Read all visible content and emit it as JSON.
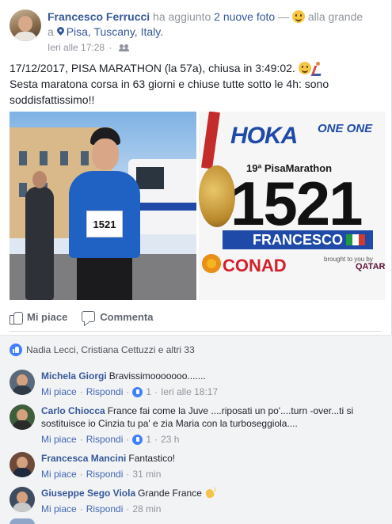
{
  "post": {
    "author": "Francesco Ferrucci",
    "action": " ha aggiunto ",
    "photos_link": "2 nuove foto",
    "feeling_sep": " — ",
    "feeling": " alla grande",
    "at": "a ",
    "location": "Pisa, Tuscany, Italy.",
    "timestamp": "Ieri alle 17:28",
    "audience_sep": "·",
    "text_line1": "17/12/2017, PISA MARATHON (la 57a), chiusa in 3:49:02.",
    "text_line2": "Sesta maratona corsa in 63 giorni e chiuse tutte sotto le 4h: sono soddisfattissimo!!"
  },
  "photos": {
    "left": {
      "bib_number": "1521"
    },
    "right": {
      "brand": "HOKA",
      "brand_sub": "ONE ONE",
      "event": "19ª PisaMarathon",
      "bib_number": "1521",
      "runner_name": "FRANCESCO",
      "sponsor": "CONAD",
      "sponsor2_text": "brought to you by",
      "airline": "QATAR"
    }
  },
  "actions": {
    "like_label": "Mi piace",
    "comment_label": "Commenta"
  },
  "reactions": {
    "names": "Nadia Lecci, Cristiana Cettuzzi e altri 33"
  },
  "comments": [
    {
      "author": "Michela Giorgi",
      "text": "Bravissimooooooo.......",
      "like": "Mi piace",
      "reply": "Rispondi",
      "likes": "1",
      "time": "Ieri alle 18:17",
      "avatar_color": "#5a6a7a"
    },
    {
      "author": "Carlo Chiocca",
      "text": "France fai come la Juve ....riposati un po'....turn -over...ti si sostituisce io Cinzia tu pa' e zia Maria con la turboseggiola....",
      "like": "Mi piace",
      "reply": "Rispondi",
      "likes": "1",
      "time": "23 h",
      "avatar_color": "#3e5e3c"
    },
    {
      "author": "Francesca Mancini",
      "text": "Fantastico!",
      "like": "Mi piace",
      "reply": "Rispondi",
      "time": "31 min",
      "avatar_color": "#6d4a3a"
    },
    {
      "author": "Giuseppe Sego Viola",
      "text": "Grande France",
      "like": "Mi piace",
      "reply": "Rispondi",
      "time": "28 min",
      "avatar_color": "#3f4c60"
    }
  ],
  "colors": {
    "link": "#365899",
    "reaction_blue": "#4080ff",
    "muted": "#90949c"
  }
}
